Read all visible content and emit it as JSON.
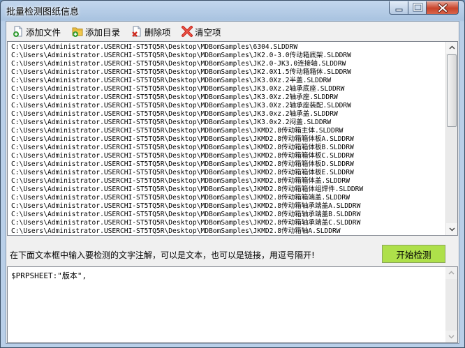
{
  "window": {
    "title": "批量检测图纸信息"
  },
  "toolbar": {
    "add_file": "添加文件",
    "add_dir": "添加目录",
    "delete": "删除项",
    "clear": "清空项"
  },
  "file_list": [
    "C:\\Users\\Administrator.USERCHI-ST5TQ5R\\Desktop\\MDBomSamples\\6304.SLDDRW",
    "C:\\Users\\Administrator.USERCHI-ST5TQ5R\\Desktop\\MDBomSamples\\JK2.0-3.0传动箱底架.SLDDRW",
    "C:\\Users\\Administrator.USERCHI-ST5TQ5R\\Desktop\\MDBomSamples\\JK2.0-JK3.0连接轴.SLDDRW",
    "C:\\Users\\Administrator.USERCHI-ST5TQ5R\\Desktop\\MDBomSamples\\JK2.0X1.5传动箱箱体.SLDDRW",
    "C:\\Users\\Administrator.USERCHI-ST5TQ5R\\Desktop\\MDBomSamples\\JK3.0Xz.2半盖.SLDDRW",
    "C:\\Users\\Administrator.USERCHI-ST5TQ5R\\Desktop\\MDBomSamples\\JK3.0Xz.2轴承底座.SLDDRW",
    "C:\\Users\\Administrator.USERCHI-ST5TQ5R\\Desktop\\MDBomSamples\\JK3.0Xz.2轴承座.SLDDRW",
    "C:\\Users\\Administrator.USERCHI-ST5TQ5R\\Desktop\\MDBomSamples\\JK3.0Xz.2轴承座装配.SLDDRW",
    "C:\\Users\\Administrator.USERCHI-ST5TQ5R\\Desktop\\MDBomSamples\\JK3.0xz.2轴承盖.SLDDRW",
    "C:\\Users\\Administrator.USERCHI-ST5TQ5R\\Desktop\\MDBomSamples\\JK3.0x2.2闷盖.SLDDRW",
    "C:\\Users\\Administrator.USERCHI-ST5TQ5R\\Desktop\\MDBomSamples\\JKMD2.8传动箱主体.SLDDRW",
    "C:\\Users\\Administrator.USERCHI-ST5TQ5R\\Desktop\\MDBomSamples\\JKMD2.8传动箱箱体板A.SLDDRW",
    "C:\\Users\\Administrator.USERCHI-ST5TQ5R\\Desktop\\MDBomSamples\\JKMD2.8传动箱箱体板B.SLDDRW",
    "C:\\Users\\Administrator.USERCHI-ST5TQ5R\\Desktop\\MDBomSamples\\JKMD2.8传动箱箱体板C.SLDDRW",
    "C:\\Users\\Administrator.USERCHI-ST5TQ5R\\Desktop\\MDBomSamples\\JKMD2.8传动箱箱体板D.SLDDRW",
    "C:\\Users\\Administrator.USERCHI-ST5TQ5R\\Desktop\\MDBomSamples\\JKMD2.8传动箱箱体板E.SLDDRW",
    "C:\\Users\\Administrator.USERCHI-ST5TQ5R\\Desktop\\MDBomSamples\\JKMD2.8传动箱箱体盖.SLDDRW",
    "C:\\Users\\Administrator.USERCHI-ST5TQ5R\\Desktop\\MDBomSamples\\JKMD2.8传动箱箱体组焊件.SLDDRW",
    "C:\\Users\\Administrator.USERCHI-ST5TQ5R\\Desktop\\MDBomSamples\\JKMD2.8传动箱箱端盖.SLDDRW",
    "C:\\Users\\Administrator.USERCHI-ST5TQ5R\\Desktop\\MDBomSamples\\JKMD2.8传动箱轴承端盖A.SLDDRW",
    "C:\\Users\\Administrator.USERCHI-ST5TQ5R\\Desktop\\MDBomSamples\\JKMD2.8传动箱轴承端盖B.SLDDRW",
    "C:\\Users\\Administrator.USERCHI-ST5TQ5R\\Desktop\\MDBomSamples\\JKMD2.8传动箱轴承端盖C.SLDDRW",
    "C:\\Users\\Administrator.USERCHI-ST5TQ5R\\Desktop\\MDBomSamples\\JKMD2.8传动箱轴A.SLDDRW"
  ],
  "hint": "在下面文本框中输入要检测的文字注解，可以是文本，也可以是链接，用逗号隔开!",
  "start_button": "开始检测",
  "annotation_text": "$PRPSHEET:\"版本\","
}
